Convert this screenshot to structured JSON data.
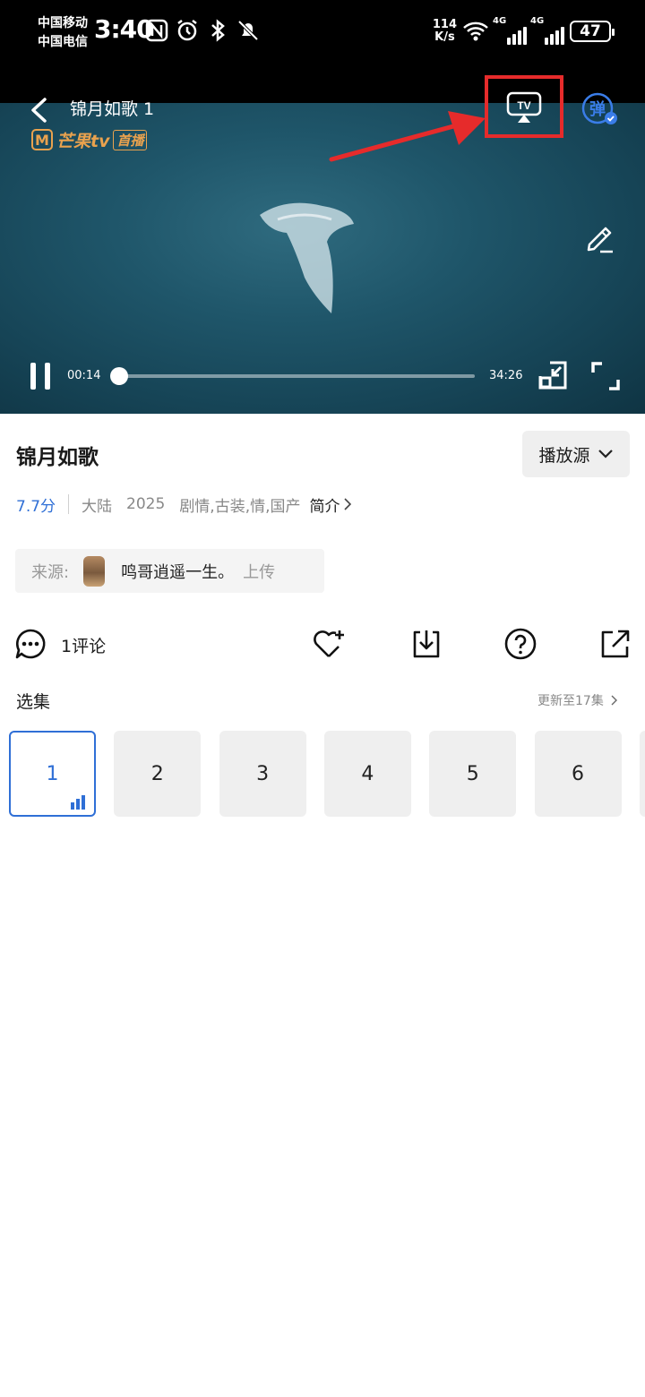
{
  "status_bar": {
    "carrier_1": "中国移动",
    "carrier_2": "中国电信",
    "time": "3:40",
    "net_speed_value": "114",
    "net_speed_unit": "K/s",
    "sim1_label": "4G",
    "sim2_label": "4G",
    "battery": "47"
  },
  "player": {
    "title": "锦月如歌 1",
    "logo_text": "芒果tv",
    "logo_badge": "首播",
    "cast_icon_label": "TV",
    "danmu_label": "弹",
    "current_time": "00:14",
    "total_time": "34:26",
    "progress": 0.0068
  },
  "info": {
    "title": "锦月如歌",
    "source_button": "播放源",
    "score": "7.7分",
    "region": "大陆",
    "year": "2025",
    "genres": "剧情,古装,情,国产",
    "intro_link": "简介",
    "uploader_label": "来源:",
    "uploader_name": "鸣哥逍遥一生。",
    "uploader_suffix": "上传"
  },
  "actions": {
    "comment_label": "1评论"
  },
  "episodes": {
    "title": "选集",
    "update_text": "更新至17集",
    "items": [
      "1",
      "2",
      "3",
      "4",
      "5",
      "6"
    ],
    "active_index": 0
  },
  "colors": {
    "accent": "#2f6fd6",
    "highlight": "#e62b2b",
    "logo": "#e9a24e"
  }
}
